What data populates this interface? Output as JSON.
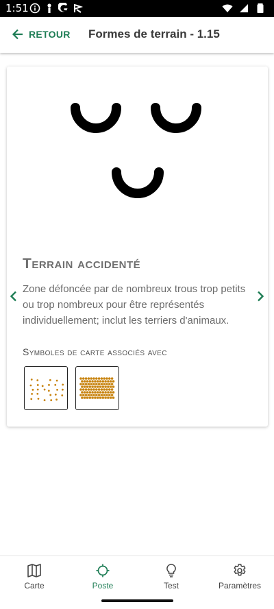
{
  "status_bar": {
    "time": "1:51",
    "left_icons": [
      "info-circle-icon",
      "person-icon",
      "google-g-icon",
      "flag-icon"
    ],
    "right_icons": [
      "wifi-icon",
      "cell-signal-icon",
      "battery-icon"
    ]
  },
  "app_bar": {
    "back_label": "RETOUR",
    "title": "Formes de terrain - 1.15"
  },
  "term": {
    "title": "Terrain accidenté",
    "description": "Zone défoncée par de nombreux trous trop petits ou trop nombreux pour être représentés individuellement; inclut les terriers d'animaux.",
    "associated_title": "Symboles de carte associés avec",
    "symbols": [
      "dotted-sparse-symbol",
      "dotted-dense-symbol"
    ]
  },
  "colors": {
    "accent": "#1e7d55",
    "symbol_brown": "#c88410"
  },
  "bottom_nav": {
    "items": [
      {
        "label": "Carte",
        "icon": "map-icon"
      },
      {
        "label": "Poste",
        "icon": "crosshair-icon",
        "active": true
      },
      {
        "label": "Test",
        "icon": "lightbulb-icon"
      },
      {
        "label": "Paramètres",
        "icon": "gear-icon"
      }
    ]
  }
}
